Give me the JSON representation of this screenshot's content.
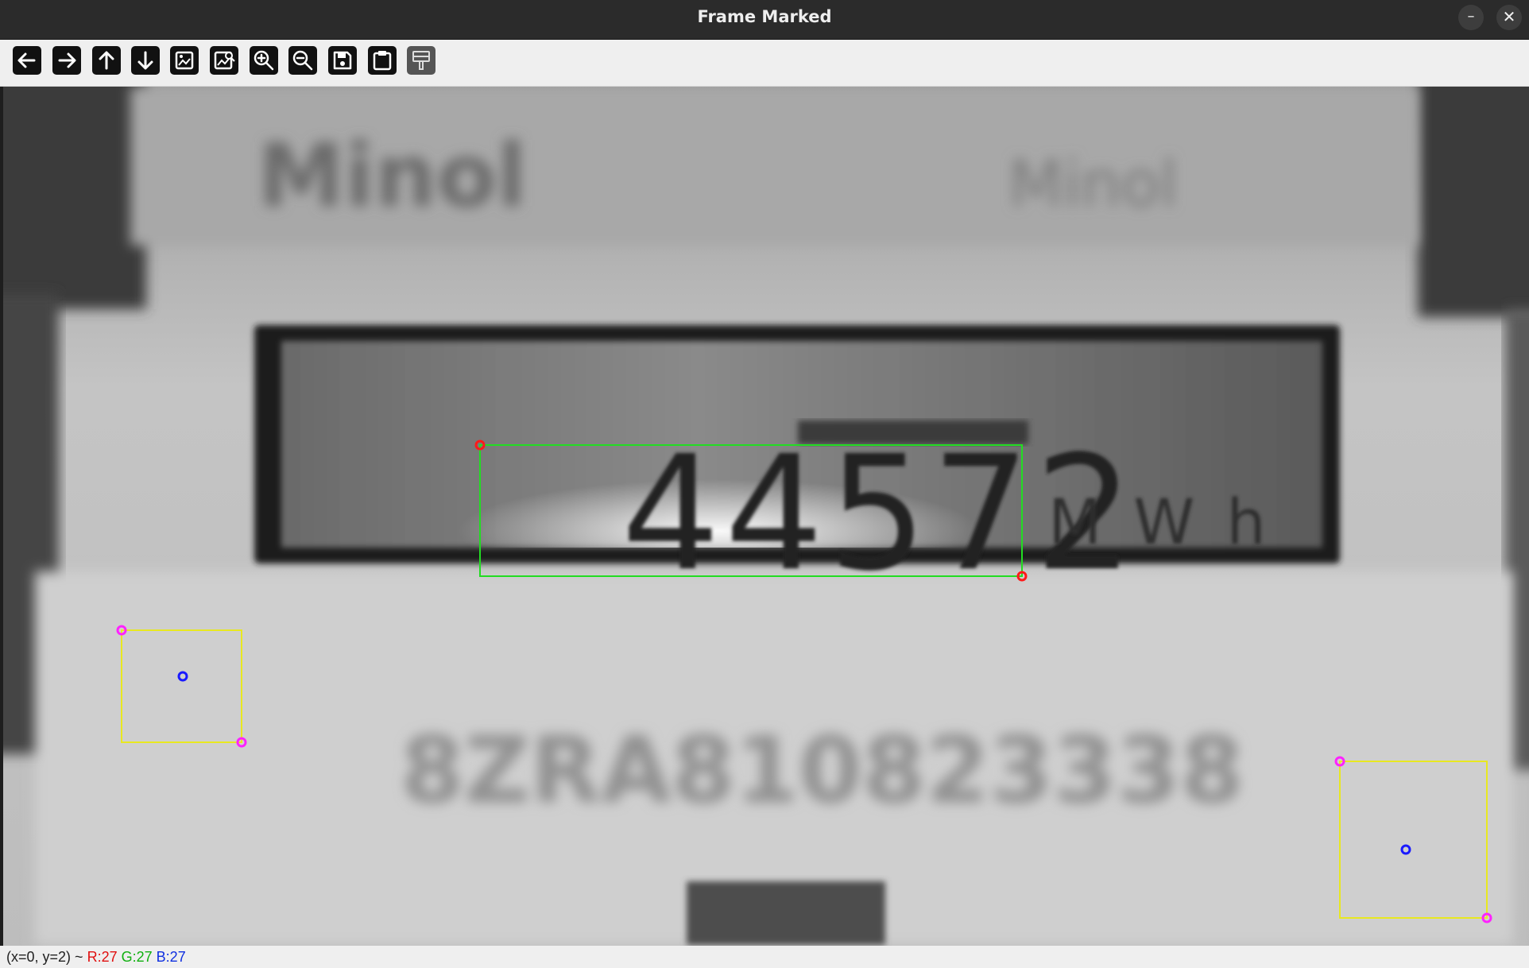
{
  "window": {
    "title": "Frame Marked",
    "minimize_label": "–",
    "close_label": "✕"
  },
  "toolbar": {
    "buttons": [
      {
        "name": "pan-left-icon"
      },
      {
        "name": "pan-right-icon"
      },
      {
        "name": "pan-up-icon"
      },
      {
        "name": "pan-down-icon"
      },
      {
        "name": "zoom-fit-icon"
      },
      {
        "name": "zoom-original-icon"
      },
      {
        "name": "zoom-in-icon"
      },
      {
        "name": "zoom-out-icon"
      },
      {
        "name": "save-icon"
      },
      {
        "name": "copy-clipboard-icon"
      },
      {
        "name": "properties-icon"
      }
    ]
  },
  "image": {
    "brand_text": "Minol",
    "brand_right_text": "Minol",
    "display_value": "44572",
    "unit": "MWh",
    "serial": "8ZRA810823338",
    "marker_colors": {
      "roi": "#22dd22",
      "roi_corner": "#ff1a1a",
      "tracking_box": "#e8e820",
      "tracking_corner": "#ff22ff",
      "tracking_center": "#1a1aff"
    }
  },
  "status": {
    "coords": "(x=0, y=2) ~",
    "r": "R:27",
    "g": "G:27",
    "b": "B:27"
  }
}
